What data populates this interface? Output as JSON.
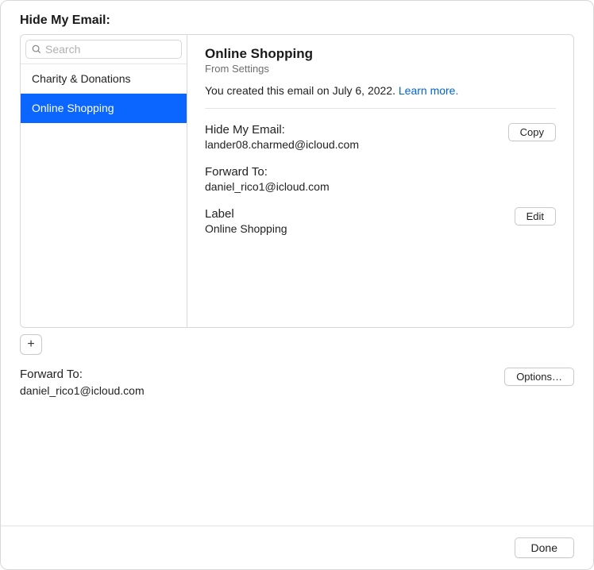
{
  "header": {
    "title": "Hide My Email:"
  },
  "search": {
    "placeholder": "Search"
  },
  "sidebar": {
    "items": [
      {
        "label": "Charity & Donations",
        "selected": false
      },
      {
        "label": "Online Shopping",
        "selected": true
      }
    ]
  },
  "detail": {
    "title": "Online Shopping",
    "subtitle": "From Settings",
    "created_prefix": "You created this email on ",
    "created_date": "July 6, 2022",
    "created_suffix": ". ",
    "learn_more": "Learn more.",
    "hide_my_email_label": "Hide My Email:",
    "hide_my_email_value": "lander08.charmed@icloud.com",
    "copy_button": "Copy",
    "forward_to_label": "Forward To:",
    "forward_to_value": "daniel_rico1@icloud.com",
    "label_label": "Label",
    "label_value": "Online Shopping",
    "edit_button": "Edit"
  },
  "add_button": "+",
  "global_forward": {
    "label": "Forward To:",
    "value": "daniel_rico1@icloud.com",
    "options_button": "Options…"
  },
  "footer": {
    "done_button": "Done"
  }
}
